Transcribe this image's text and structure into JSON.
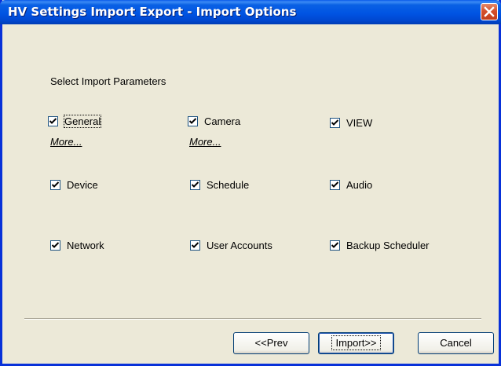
{
  "window": {
    "title": "HV Settings Import Export - Import Options"
  },
  "section_title": "Select Import Parameters",
  "options": {
    "general": {
      "label": "General",
      "checked": true
    },
    "camera": {
      "label": "Camera",
      "checked": true
    },
    "view": {
      "label": "VIEW",
      "checked": true
    },
    "device": {
      "label": "Device",
      "checked": true
    },
    "schedule": {
      "label": "Schedule",
      "checked": true
    },
    "audio": {
      "label": "Audio",
      "checked": true
    },
    "network": {
      "label": "Network",
      "checked": true
    },
    "user_accounts": {
      "label": "User Accounts",
      "checked": true
    },
    "backup_scheduler": {
      "label": "Backup Scheduler",
      "checked": true
    }
  },
  "links": {
    "general_more": "More...",
    "camera_more": "More..."
  },
  "buttons": {
    "prev": "<<Prev",
    "import": "Import>>",
    "cancel": "Cancel"
  },
  "icons": {
    "close": "close-icon",
    "checkmark": "checkmark-icon"
  },
  "colors": {
    "titlebar": "#0054e3",
    "close_button": "#d5502b",
    "dialog_bg": "#ece9d8"
  }
}
